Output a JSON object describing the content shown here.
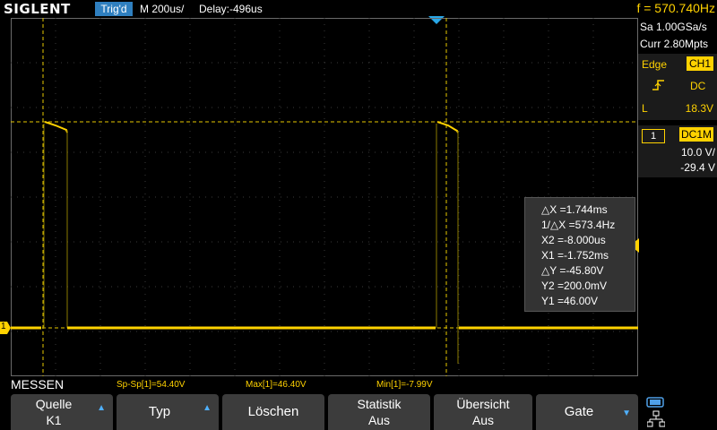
{
  "header": {
    "logo": "SIGLENT",
    "trigger_status": "Trig'd",
    "timebase": "M 200us/",
    "delay": "Delay:-496us",
    "frequency": "f = 570.740Hz"
  },
  "acquisition": {
    "sample_rate": "Sa 1.00GSa/s",
    "memory": "Curr 2.80Mpts"
  },
  "trigger": {
    "type": "Edge",
    "source": "CH1",
    "coupling": "DC",
    "level_label": "L",
    "level": "18.3V"
  },
  "channel": {
    "number": "1",
    "coupling_impedance": "DC1M",
    "scale": "10.0 V/",
    "offset": "-29.4 V",
    "marker": "1"
  },
  "cursors": {
    "dx": "△X =1.744ms",
    "inv_dx": "1/△X =573.4Hz",
    "x2": "X2 =-8.000us",
    "x1": "X1 =-1.752ms",
    "dy": "△Y =-45.80V",
    "y2": "Y2 =200.0mV",
    "y1": "Y1 =46.00V"
  },
  "measure": {
    "title": "MESSEN",
    "sp_sp": "Sp-Sp[1]=54.40V",
    "max": "Max[1]=46.40V",
    "min": "Min[1]=-7.99V"
  },
  "menu": {
    "quelle_line1": "Quelle",
    "quelle_line2": "K1",
    "typ": "Typ",
    "loeschen": "Löschen",
    "statistik_line1": "Statistik",
    "statistik_line2": "Aus",
    "uebersicht_line1": "Übersicht",
    "uebersicht_line2": "Aus",
    "gate": "Gate"
  },
  "colors": {
    "trace": "#ffd200",
    "accent": "#2f7fbf",
    "grid": "#6a6a6a"
  }
}
